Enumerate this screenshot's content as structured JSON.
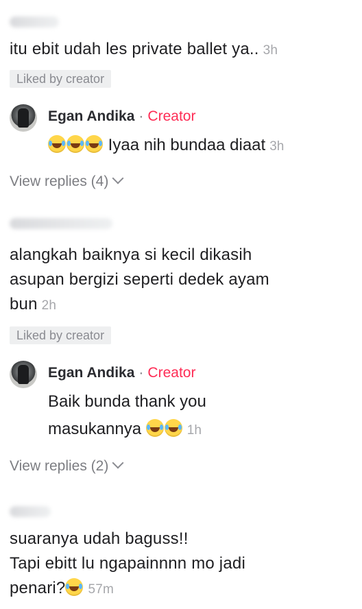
{
  "comments": [
    {
      "text": "itu ebit udah les private ballet ya..",
      "time": "3h",
      "liked": "Liked by creator",
      "reply": {
        "name": "Egan Andika",
        "separator": "·",
        "badge": "Creator",
        "text": "Iyaa nih bundaa diaat",
        "time": "3h",
        "emoji_count": 3
      },
      "view_replies": "View replies (4)"
    },
    {
      "text_lines": [
        "alangkah baiknya si kecil dikasih",
        "asupan bergizi seperti dedek ayam",
        "bun"
      ],
      "time": "2h",
      "liked": "Liked by creator",
      "reply": {
        "name": "Egan Andika",
        "separator": "·",
        "badge": "Creator",
        "text_line1": "Baik bunda thank you",
        "text_line2": "masukannya",
        "time": "1h",
        "emoji_count": 2
      },
      "view_replies": "View replies (2)"
    },
    {
      "text_lines": [
        "suaranya udah baguss!!",
        "Tapi ebitt lu ngapainnnn mo jadi",
        "penari?"
      ],
      "time": "57m",
      "emoji_count": 1
    }
  ],
  "icons": {
    "emoji": "face-with-tears-of-joy-icon",
    "chevron": "chevron-down-icon",
    "avatar": "user-avatar"
  },
  "colors": {
    "creator_badge": "#fe2c55",
    "timestamp": "#a6a7ab",
    "liked_bg": "#eeeff0"
  }
}
